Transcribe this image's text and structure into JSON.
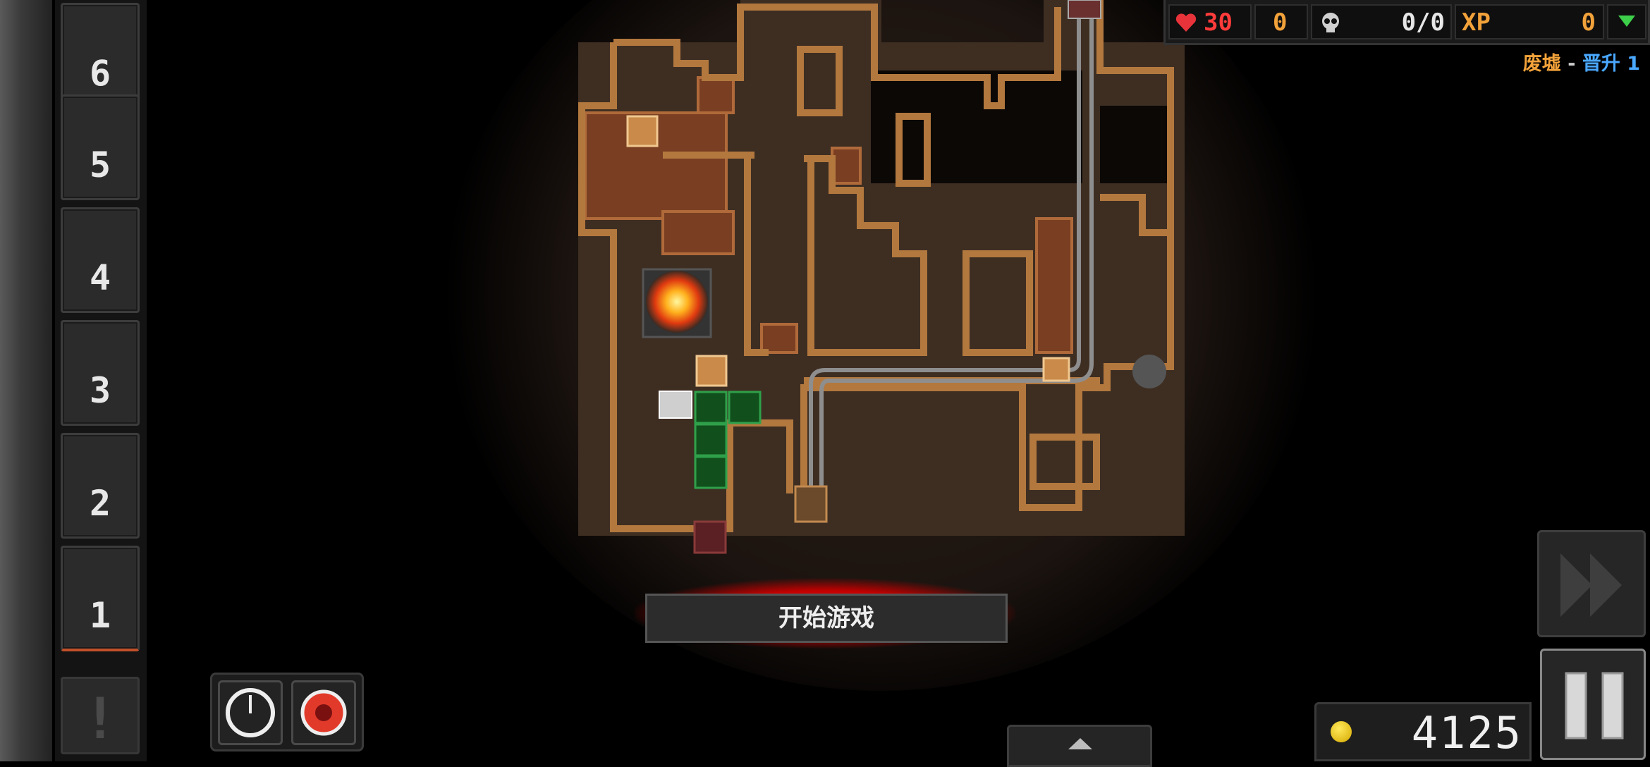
{
  "waves": [
    {
      "label": "6"
    },
    {
      "label": "5"
    },
    {
      "label": "4"
    },
    {
      "label": "3"
    },
    {
      "label": "2"
    },
    {
      "label": "1"
    }
  ],
  "alert_label": "!",
  "hud": {
    "lives": "30",
    "gold_bonus": "0",
    "kills": "0/0",
    "xp_label": "XP",
    "xp_value": "0",
    "colors": {
      "lives": "#ff3b3b",
      "gold": "#f2a23a",
      "xp": "#f2a23a",
      "accent_green": "#3ecf4a"
    }
  },
  "level": {
    "name": "废墟",
    "separator": "-",
    "ascension": "晋升 1",
    "colors": {
      "name": "#f2a23a",
      "ascension": "#4aa8ff"
    }
  },
  "start_button": {
    "label": "开始游戏"
  },
  "gold_total": "4125",
  "icons": {
    "lives": "heart-icon",
    "gold_bonus": "gold-icon",
    "kills": "skull-icon",
    "xp_toggle": "triangle-down-icon",
    "fast_forward": "fast-forward-icon",
    "pause": "pause-icon",
    "drawer": "chevron-up-icon",
    "tool_1": "timer-icon",
    "tool_2": "bomb-icon",
    "coin": "coin-icon"
  }
}
